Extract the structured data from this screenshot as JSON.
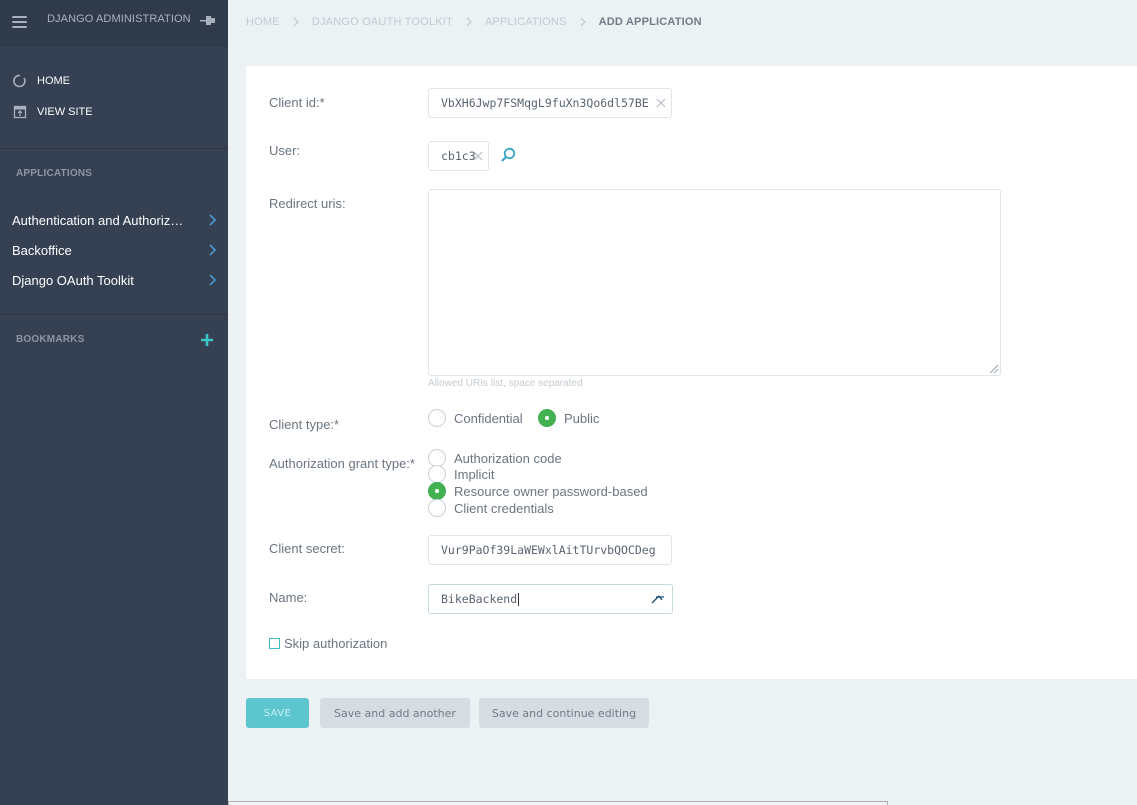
{
  "sidebar": {
    "title": "DJANGO ADMINISTRATION",
    "links": [
      {
        "label": "HOME",
        "icon": "home-circle-icon"
      },
      {
        "label": "VIEW SITE",
        "icon": "view-site-icon"
      }
    ],
    "applications_header": "APPLICATIONS",
    "apps": [
      {
        "label": "Authentication and Authorization"
      },
      {
        "label": "Backoffice"
      },
      {
        "label": "Django OAuth Toolkit"
      }
    ],
    "bookmarks_header": "BOOKMARKS"
  },
  "breadcrumb": {
    "items": [
      "HOME",
      "DJANGO OAUTH TOOLKIT",
      "APPLICATIONS"
    ],
    "current": "ADD APPLICATION"
  },
  "form": {
    "client_id": {
      "label": "Client id:*",
      "value": "VbXH6Jwp7FSMqgL9fuXn3Qo6dl57BE"
    },
    "user": {
      "label": "User:",
      "value": "cb1c3"
    },
    "redirect_uris": {
      "label": "Redirect uris:",
      "value": "",
      "help": "Allowed URIs list, space separated"
    },
    "client_type": {
      "label": "Client type:*",
      "options": [
        {
          "label": "Confidential",
          "selected": false
        },
        {
          "label": "Public",
          "selected": true
        }
      ]
    },
    "grant_type": {
      "label": "Authorization grant type:*",
      "options": [
        {
          "label": "Authorization code",
          "selected": false
        },
        {
          "label": "Implicit",
          "selected": false
        },
        {
          "label": "Resource owner password-based",
          "selected": true
        },
        {
          "label": "Client credentials",
          "selected": false
        }
      ]
    },
    "client_secret": {
      "label": "Client secret:",
      "value": "Vur9PaOf39LaWEWxlAitTUrvbQOCDeg"
    },
    "name": {
      "label": "Name:",
      "value": "BikeBackend"
    },
    "skip_authorization": {
      "label": "Skip authorization",
      "checked": false
    }
  },
  "buttons": {
    "save": "SAVE",
    "save_add_another": "Save and add another",
    "save_continue": "Save and continue editing"
  },
  "colors": {
    "sidebar_bg": "#354052",
    "accent_teal": "#5dc5cd",
    "radio_on": "#43b152",
    "link_blue": "#3aa3c5"
  }
}
